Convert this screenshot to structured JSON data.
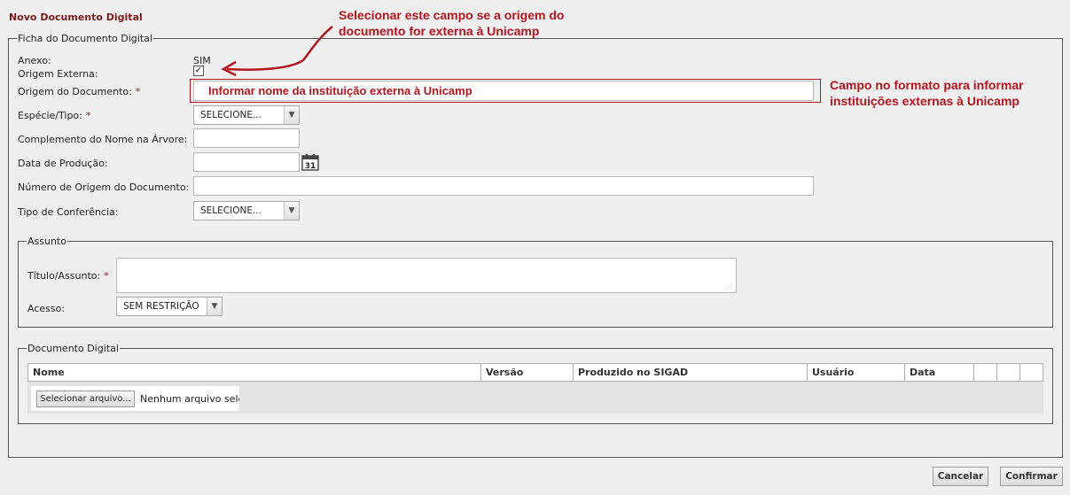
{
  "page_title": "Novo Documento Digital",
  "annotations": {
    "checkbox_note": [
      "Selecionar este campo se a origem do",
      "documento for externa à Unicamp"
    ],
    "field_note": [
      "Campo no formato para informar",
      "instituições externas à Unicamp"
    ],
    "origin_hint": "Informar nome da instituição externa à Unicamp"
  },
  "ficha": {
    "legend": "Ficha do Documento Digital",
    "anexo_label": "Anexo:",
    "anexo_value": "SIM",
    "origem_externa_label": "Origem Externa:",
    "origem_externa_checked": "✓",
    "origem_documento_label": "Origem do Documento:",
    "required_mark": "*",
    "especie_label": "Espécie/Tipo:",
    "especie_value": "SELECIONE...",
    "complemento_label": "Complemento do Nome na Árvore:",
    "data_producao_label": "Data de Produção:",
    "calendar_day": "31",
    "numero_origem_label": "Número de Origem do Documento:",
    "tipo_conferencia_label": "Tipo de Conferência:",
    "tipo_conferencia_value": "SELECIONE..."
  },
  "assunto": {
    "legend": "Assunto",
    "titulo_label": "Título/Assunto:",
    "acesso_label": "Acesso:",
    "acesso_value": "SEM RESTRIÇÃO"
  },
  "documento_digital": {
    "legend": "Documento Digital",
    "columns": [
      "Nome",
      "Versão",
      "Produzido no SIGAD",
      "Usuário",
      "Data",
      "",
      "",
      ""
    ],
    "file_button": "Selecionar arquivo...",
    "file_status": "Nenhum arquivo selecionado"
  },
  "actions": {
    "cancel": "Cancelar",
    "confirm": "Confirmar"
  },
  "colors": {
    "annotation": "#b4141e",
    "title": "#7a1a1a",
    "background": "#efefef"
  }
}
